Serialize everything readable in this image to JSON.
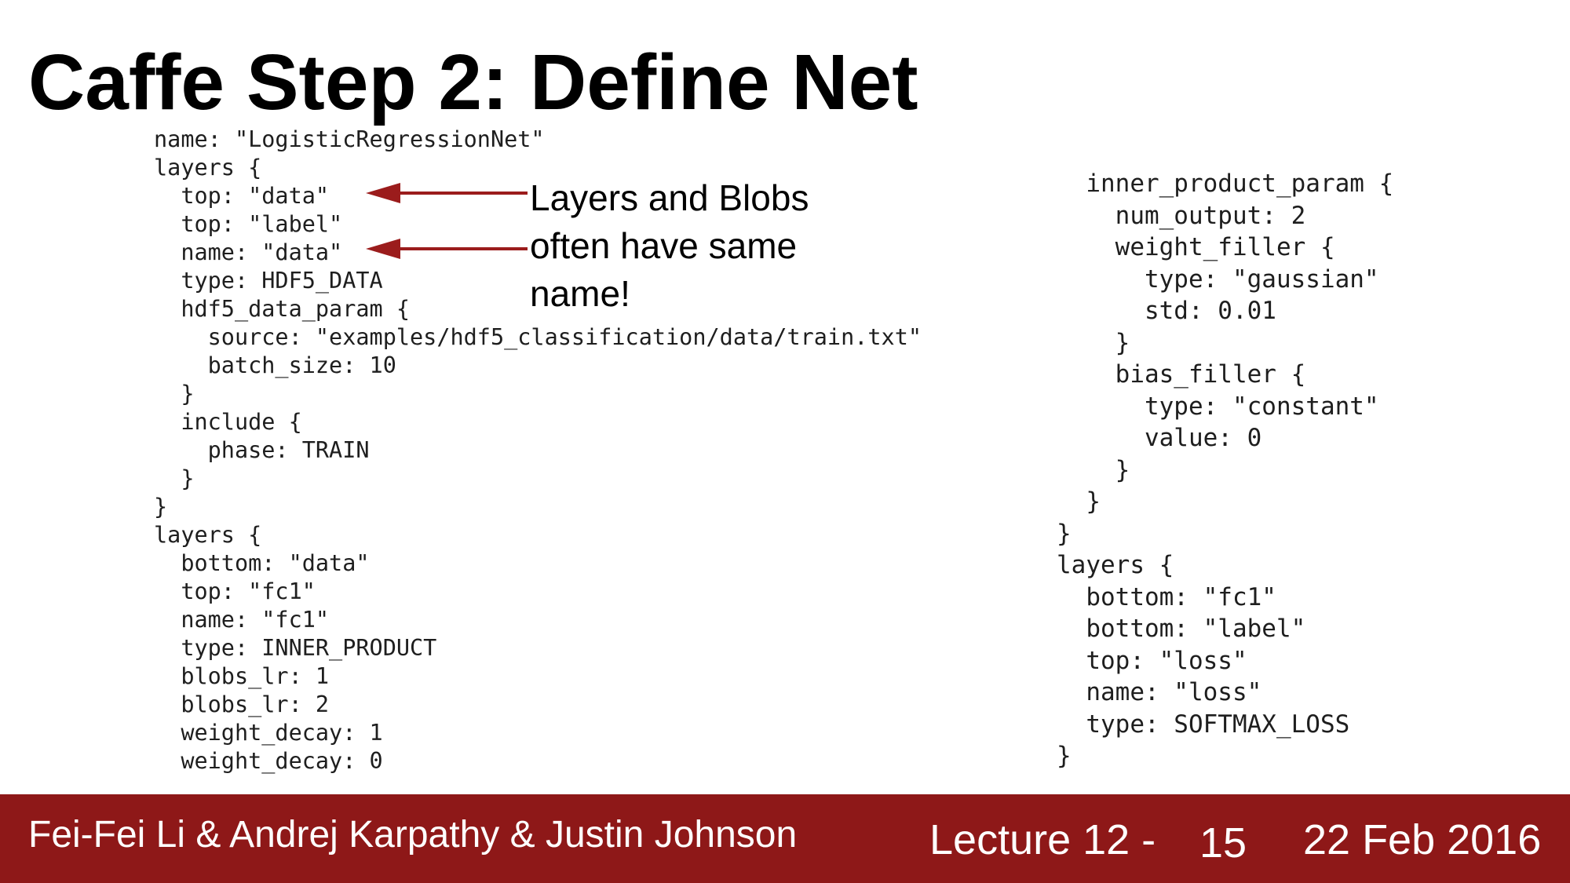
{
  "slide": {
    "title": "Caffe Step 2: Define Net"
  },
  "code_left": {
    "lines": [
      "name: \"LogisticRegressionNet\"",
      "layers {",
      "  top: \"data\"",
      "  top: \"label\"",
      "  name: \"data\"",
      "  type: HDF5_DATA",
      "  hdf5_data_param {",
      "    source: \"examples/hdf5_classification/data/train.txt\"",
      "    batch_size: 10",
      "  }",
      "  include {",
      "    phase: TRAIN",
      "  }",
      "}",
      "layers {",
      "  bottom: \"data\"",
      "  top: \"fc1\"",
      "  name: \"fc1\"",
      "  type: INNER_PRODUCT",
      "  blobs_lr: 1",
      "  blobs_lr: 2",
      "  weight_decay: 1",
      "  weight_decay: 0"
    ]
  },
  "code_right": {
    "lines": [
      "  inner_product_param {",
      "    num_output: 2",
      "    weight_filler {",
      "      type: \"gaussian\"",
      "      std: 0.01",
      "    }",
      "    bias_filler {",
      "      type: \"constant\"",
      "      value: 0",
      "    }",
      "  }",
      "}",
      "layers {",
      "  bottom: \"fc1\"",
      "  bottom: \"label\"",
      "  top: \"loss\"",
      "  name: \"loss\"",
      "  type: SOFTMAX_LOSS",
      "}"
    ]
  },
  "annotation": {
    "lines": [
      "Layers and Blobs",
      "often have same",
      "name!"
    ],
    "arrow_color": "#9b1c1c"
  },
  "footer": {
    "authors": "Fei-Fei Li & Andrej Karpathy & Justin Johnson",
    "lecture": "Lecture 12 -",
    "page": "15",
    "date": "22 Feb 2016",
    "background_color": "#8e1818"
  }
}
